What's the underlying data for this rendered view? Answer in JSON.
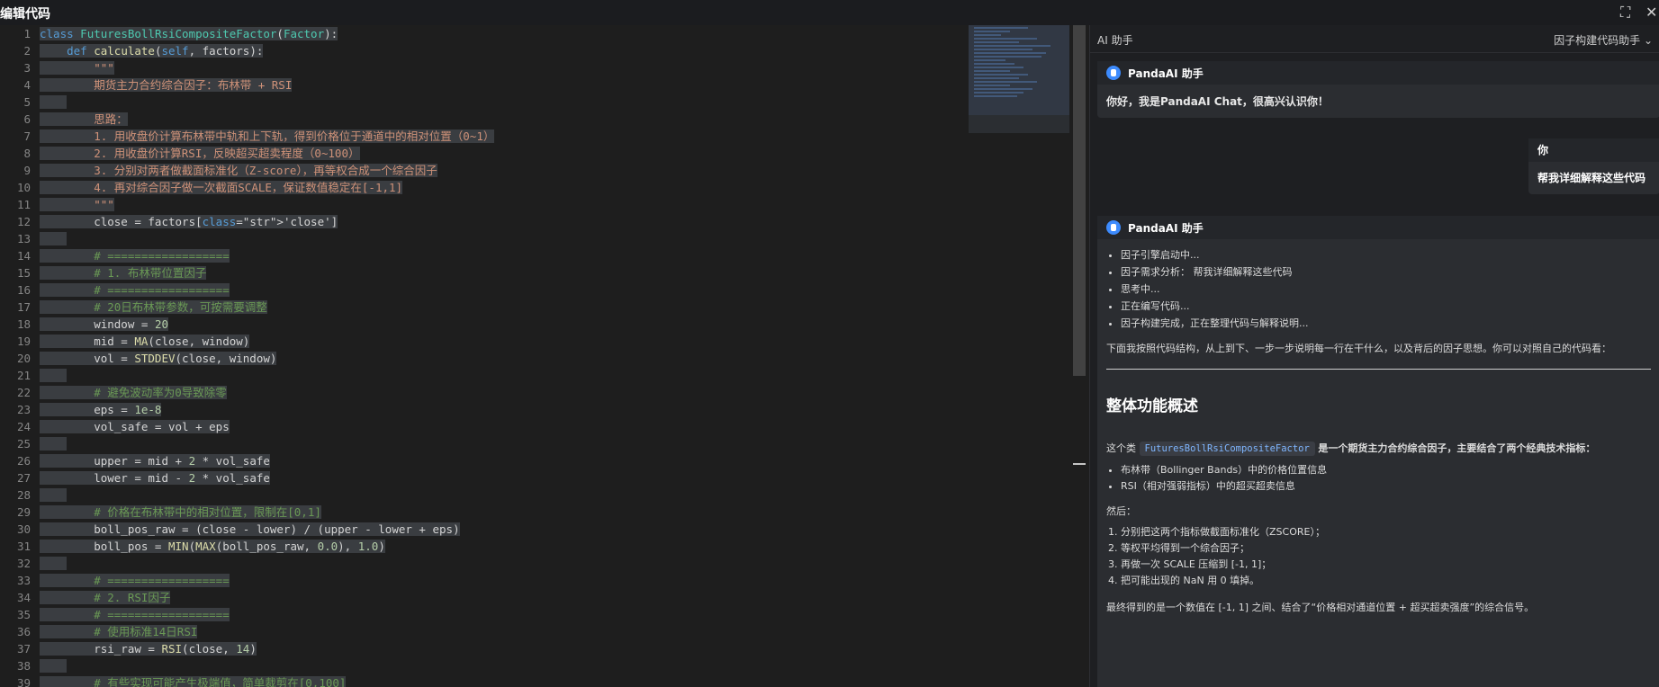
{
  "window": {
    "title": "编辑代码",
    "icons": [
      "expand-icon",
      "close-icon"
    ]
  },
  "editor": {
    "line_numbers": [
      "1",
      "2",
      "3",
      "4",
      "5",
      "6",
      "7",
      "8",
      "9",
      "10",
      "11",
      "12",
      "13",
      "14",
      "15",
      "16",
      "17",
      "18",
      "19",
      "20",
      "21",
      "22",
      "23",
      "24",
      "25",
      "26",
      "27",
      "28",
      "29",
      "30",
      "31",
      "32",
      "33",
      "34",
      "35",
      "36",
      "37",
      "38",
      "39"
    ],
    "lines": [
      "class FuturesBollRsiCompositeFactor(Factor):",
      "    def calculate(self, factors):",
      "        \"\"\"",
      "        期货主力合约综合因子：布林带 + RSI",
      "",
      "        思路：",
      "        1. 用收盘价计算布林带中轨和上下轨，得到价格位于通道中的相对位置（0~1）",
      "        2. 用收盘价计算RSI，反映超买超卖程度（0~100）",
      "        3. 分别对两者做截面标准化（Z-score），再等权合成一个综合因子",
      "        4. 再对综合因子做一次截面SCALE，保证数值稳定在[-1,1]",
      "        \"\"\"",
      "        close = factors['close']",
      "",
      "        # ==================",
      "        # 1. 布林带位置因子",
      "        # ==================",
      "        # 20日布林带参数，可按需要调整",
      "        window = 20",
      "        mid = MA(close, window)",
      "        vol = STDDEV(close, window)",
      "",
      "        # 避免波动率为0导致除零",
      "        eps = 1e-8",
      "        vol_safe = vol + eps",
      "",
      "        upper = mid + 2 * vol_safe",
      "        lower = mid - 2 * vol_safe",
      "",
      "        # 价格在布林带中的相对位置，限制在[0,1]",
      "        boll_pos_raw = (close - lower) / (upper - lower + eps)",
      "        boll_pos = MIN(MAX(boll_pos_raw, 0.0), 1.0)",
      "",
      "        # ==================",
      "        # 2. RSI因子",
      "        # ==================",
      "        # 使用标准14日RSI",
      "        rsi_raw = RSI(close, 14)",
      "",
      "        # 有些实现可能产生极端值，简单裁剪在[0,100]"
    ]
  },
  "panel": {
    "title": "AI 助手",
    "mode": "因子构建代码助手",
    "bot_name": "PandaAI 助手",
    "greeting": "你好，我是PandaAI Chat，很高兴认识你！",
    "user_name": "你",
    "user_message": "帮我详细解释这些代码",
    "status_steps": [
      "因子引擎启动中...",
      "因子需求分析： 帮我详细解释这些代码",
      "思考中...",
      "正在编写代码...",
      "因子构建完成，正在整理代码与解释说明..."
    ],
    "intro": "下面我按照代码结构，从上到下、一步一步说明每一行在干什么，以及背后的因子思想。你可以对照自己的代码看：",
    "heading": "整体功能概述",
    "desc_prefix": "这个类",
    "desc_class": "FuturesBollRsiCompositeFactor",
    "desc_suffix": "是一个期货主力合约综合因子，主要结合了两个经典技术指标：",
    "bullets": [
      "布林带（Bollinger Bands）中的价格位置信息",
      "RSI（相对强弱指标）中的超买超卖信息"
    ],
    "then": "然后：",
    "steps": [
      "分别把这两个指标做截面标准化（ZSCORE）；",
      "等权平均得到一个综合因子；",
      "再做一次 SCALE 压缩到 [-1, 1]；",
      "把可能出现的 NaN 用 0 填掉。"
    ],
    "conclusion": "最终得到的是一个数值在 [-1, 1] 之间、结合了“价格相对通道位置 + 超买超卖强度”的综合信号。"
  }
}
